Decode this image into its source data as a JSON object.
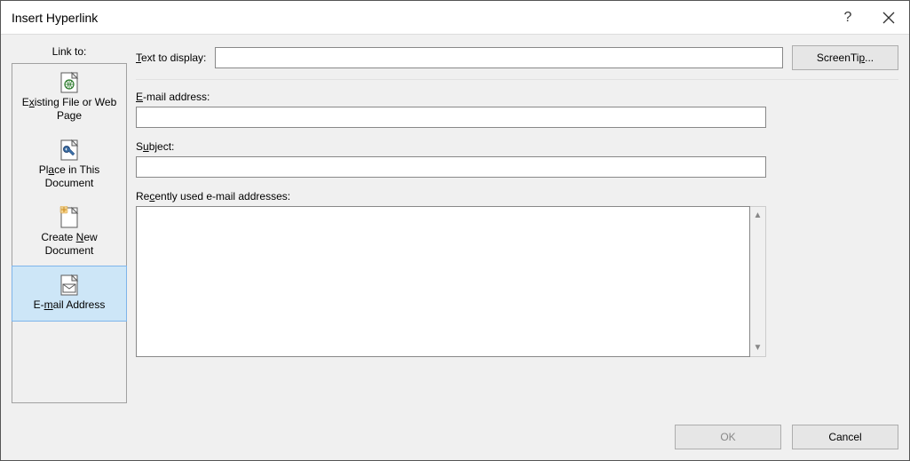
{
  "title": "Insert Hyperlink",
  "titlebar": {
    "help_tooltip": "Help"
  },
  "sidebar": {
    "label": "Link to:",
    "items": [
      {
        "pre": "E",
        "u": "x",
        "post": "isting File or Web Page"
      },
      {
        "pre": "Pl",
        "u": "a",
        "post": "ce in This Document"
      },
      {
        "pre": "Create ",
        "u": "N",
        "post": "ew Document"
      },
      {
        "pre": "E-",
        "u": "m",
        "post": "ail Address"
      }
    ]
  },
  "main": {
    "textToDisplay": {
      "pre": "",
      "u": "T",
      "post": "ext to display:",
      "value": ""
    },
    "screenTip": {
      "label": "ScreenTi",
      "u": "p",
      "post": "..."
    },
    "emailAddress": {
      "pre": "",
      "u": "E",
      "post": "-mail address:",
      "value": ""
    },
    "subject": {
      "pre": "S",
      "u": "u",
      "post": "bject:",
      "value": ""
    },
    "recent": {
      "pre": "Re",
      "u": "c",
      "post": "ently used e-mail addresses:",
      "items": []
    }
  },
  "footer": {
    "ok": "OK",
    "cancel": "Cancel"
  }
}
